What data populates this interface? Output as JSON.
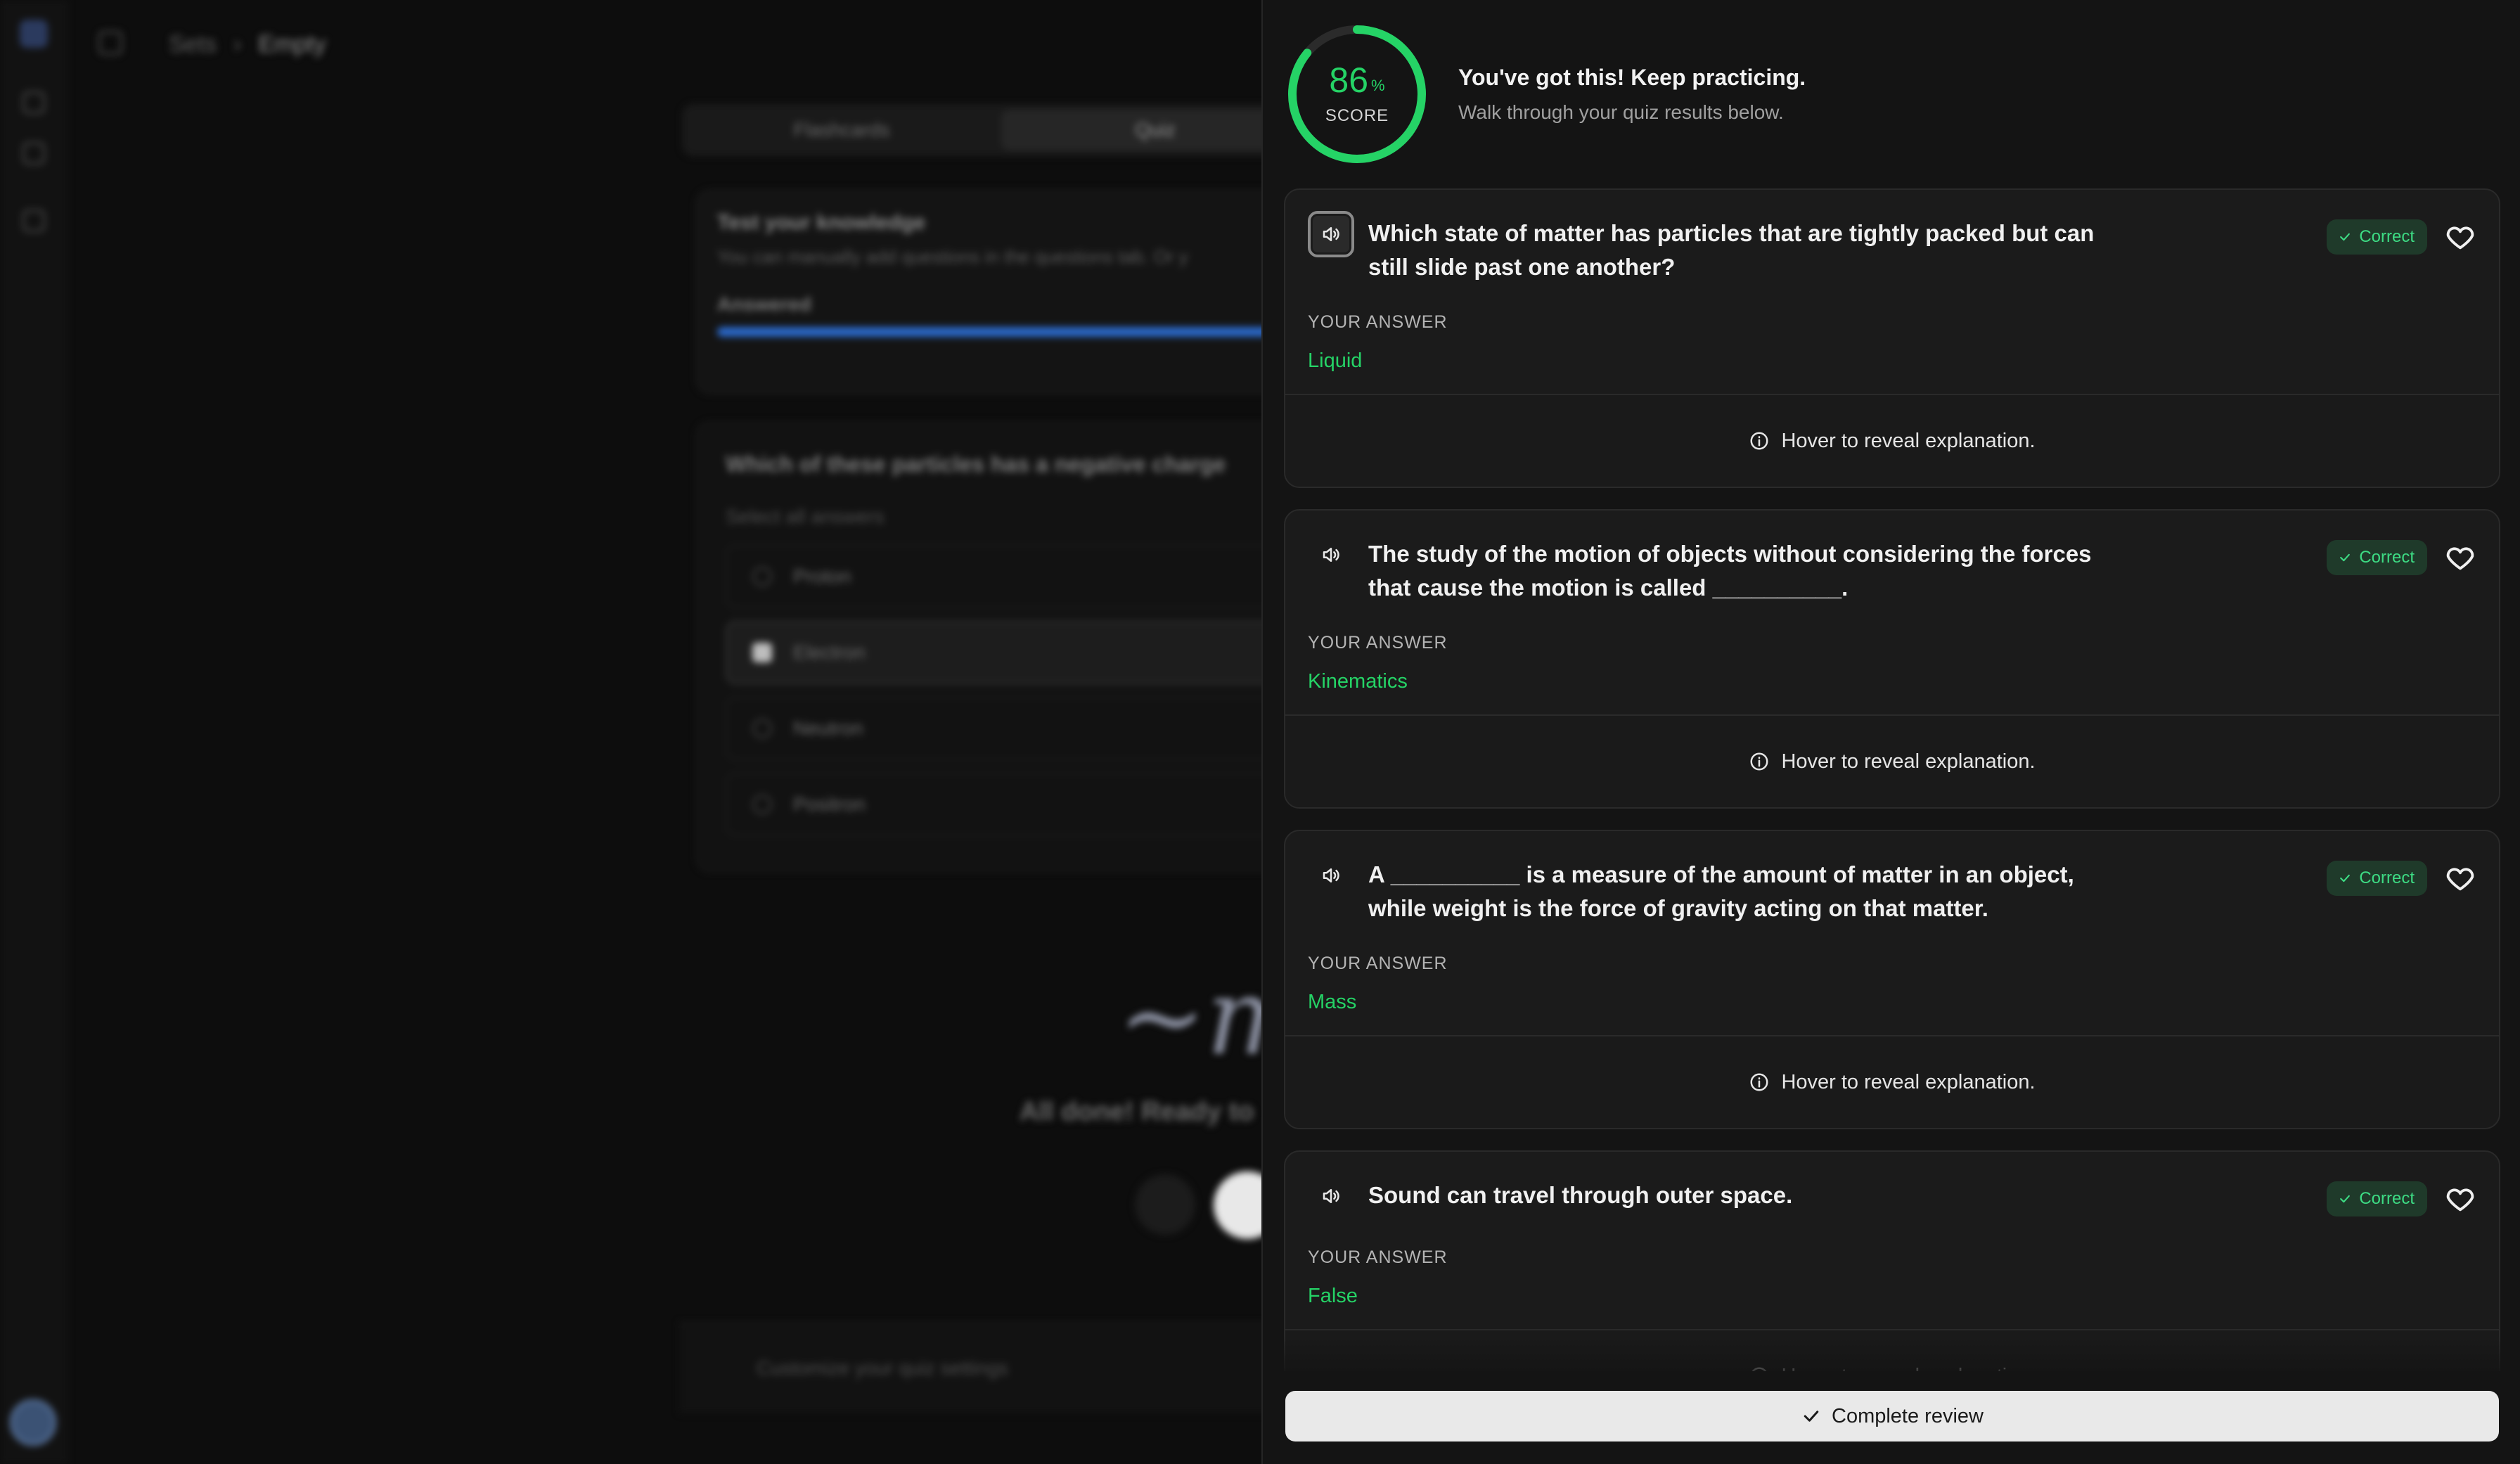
{
  "background": {
    "breadcrumb": {
      "root": "Sets",
      "sep": "›",
      "current": "Empty"
    },
    "tabs": [
      "Flashcards",
      "Quiz"
    ],
    "knowledge": {
      "title": "Test your knowledge",
      "subtitle": "You can manually add questions in the questions tab. Or y",
      "progress_label": "Answered"
    },
    "quiz": {
      "question": "Which of these particles has a negative charge",
      "hint": "Select all answers",
      "options": [
        "Proton",
        "Electron",
        "Neutron",
        "Positron"
      ]
    },
    "done_text": "All done! Ready to",
    "footer": "Customize your quiz settings"
  },
  "review": {
    "score_value": "86",
    "score_unit": "%",
    "score_label": "SCORE",
    "score_fraction": 0.86,
    "title": "You've got this! Keep practicing.",
    "subtitle": "Walk through your quiz results below.",
    "answer_label": "YOUR ANSWER",
    "explanation_hint": "Hover to reveal explanation.",
    "badge_label": "Correct",
    "questions": [
      {
        "text": "Which state of matter has particles that are tightly packed but can still slide past one another?",
        "answer": "Liquid"
      },
      {
        "text": "The study of the motion of objects without considering the forces that cause the motion is called __________.",
        "answer": "Kinematics"
      },
      {
        "text": "A __________ is a measure of the amount of matter in an object, while weight is the force of gravity acting on that matter.",
        "answer": "Mass"
      },
      {
        "text": "Sound can travel through outer space.",
        "answer": "False"
      }
    ],
    "complete_button": "Complete review"
  },
  "colors": {
    "accent_green": "#25d366",
    "badge_bg": "#1f3a2a",
    "panel_bg": "#141414"
  },
  "icons": [
    "speaker-icon",
    "check-icon",
    "heart-icon",
    "info-icon"
  ]
}
